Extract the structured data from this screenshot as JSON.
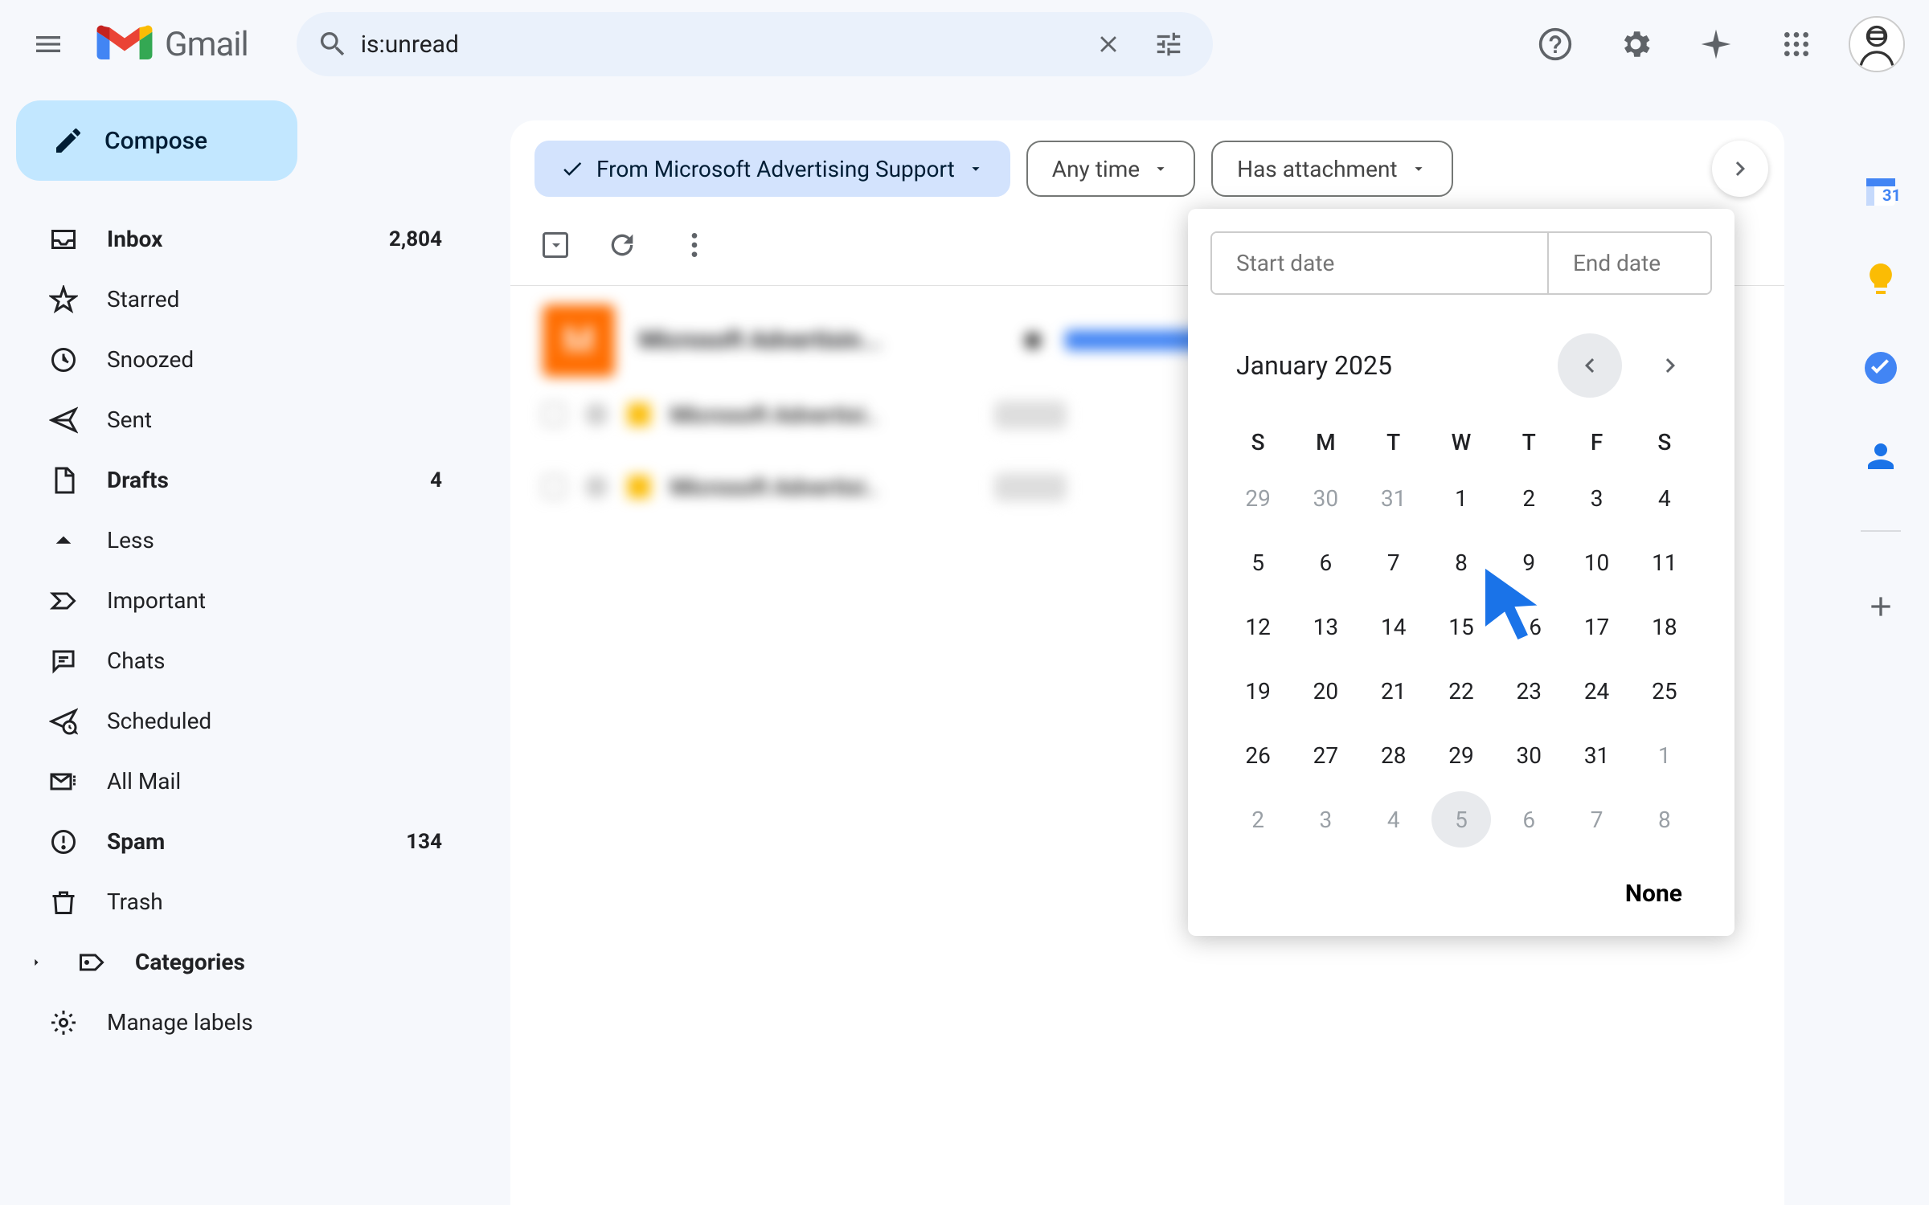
{
  "header": {
    "app_name": "Gmail",
    "search_value": "is:unread"
  },
  "compose_label": "Compose",
  "sidebar": {
    "items": [
      {
        "key": "inbox",
        "label": "Inbox",
        "count": "2,804",
        "bold": true
      },
      {
        "key": "starred",
        "label": "Starred",
        "count": "",
        "bold": false
      },
      {
        "key": "snoozed",
        "label": "Snoozed",
        "count": "",
        "bold": false
      },
      {
        "key": "sent",
        "label": "Sent",
        "count": "",
        "bold": false
      },
      {
        "key": "drafts",
        "label": "Drafts",
        "count": "4",
        "bold": true
      },
      {
        "key": "less",
        "label": "Less",
        "count": "",
        "bold": false
      },
      {
        "key": "important",
        "label": "Important",
        "count": "",
        "bold": false
      },
      {
        "key": "chats",
        "label": "Chats",
        "count": "",
        "bold": false
      },
      {
        "key": "scheduled",
        "label": "Scheduled",
        "count": "",
        "bold": false
      },
      {
        "key": "allmail",
        "label": "All Mail",
        "count": "",
        "bold": false
      },
      {
        "key": "spam",
        "label": "Spam",
        "count": "134",
        "bold": true
      },
      {
        "key": "trash",
        "label": "Trash",
        "count": "",
        "bold": false
      },
      {
        "key": "categories",
        "label": "Categories",
        "count": "",
        "bold": true
      },
      {
        "key": "managelabels",
        "label": "Manage labels",
        "count": "",
        "bold": false
      }
    ]
  },
  "filters": {
    "from": "From Microsoft Advertising Support",
    "any_time": "Any time",
    "has_attachment": "Has attachment"
  },
  "date_picker": {
    "start_placeholder": "Start date",
    "end_placeholder": "End date",
    "month_label": "January 2025",
    "weekdays": [
      "S",
      "M",
      "T",
      "W",
      "T",
      "F",
      "S"
    ],
    "days": [
      {
        "n": "29",
        "muted": true
      },
      {
        "n": "30",
        "muted": true
      },
      {
        "n": "31",
        "muted": true
      },
      {
        "n": "1"
      },
      {
        "n": "2"
      },
      {
        "n": "3"
      },
      {
        "n": "4"
      },
      {
        "n": "5"
      },
      {
        "n": "6"
      },
      {
        "n": "7"
      },
      {
        "n": "8"
      },
      {
        "n": "9"
      },
      {
        "n": "10"
      },
      {
        "n": "11"
      },
      {
        "n": "12"
      },
      {
        "n": "13"
      },
      {
        "n": "14"
      },
      {
        "n": "15"
      },
      {
        "n": "16"
      },
      {
        "n": "17"
      },
      {
        "n": "18"
      },
      {
        "n": "19"
      },
      {
        "n": "20"
      },
      {
        "n": "21"
      },
      {
        "n": "22"
      },
      {
        "n": "23"
      },
      {
        "n": "24"
      },
      {
        "n": "25"
      },
      {
        "n": "26"
      },
      {
        "n": "27"
      },
      {
        "n": "28"
      },
      {
        "n": "29"
      },
      {
        "n": "30"
      },
      {
        "n": "31"
      },
      {
        "n": "1",
        "muted": true
      },
      {
        "n": "2",
        "muted": true
      },
      {
        "n": "3",
        "muted": true
      },
      {
        "n": "4",
        "muted": true
      },
      {
        "n": "5",
        "muted": true,
        "hover": true
      },
      {
        "n": "6",
        "muted": true
      },
      {
        "n": "7",
        "muted": true
      },
      {
        "n": "8",
        "muted": true
      }
    ],
    "none_label": "None"
  },
  "mail_preview": {
    "avatar_letter": "M",
    "sender": "Microsoft Advertisin...",
    "row2_sender": "Microsoft Advertisi..",
    "row3_sender": "Microsoft Advertisi.."
  },
  "side_apps": [
    "calendar",
    "keep",
    "tasks",
    "contacts"
  ]
}
